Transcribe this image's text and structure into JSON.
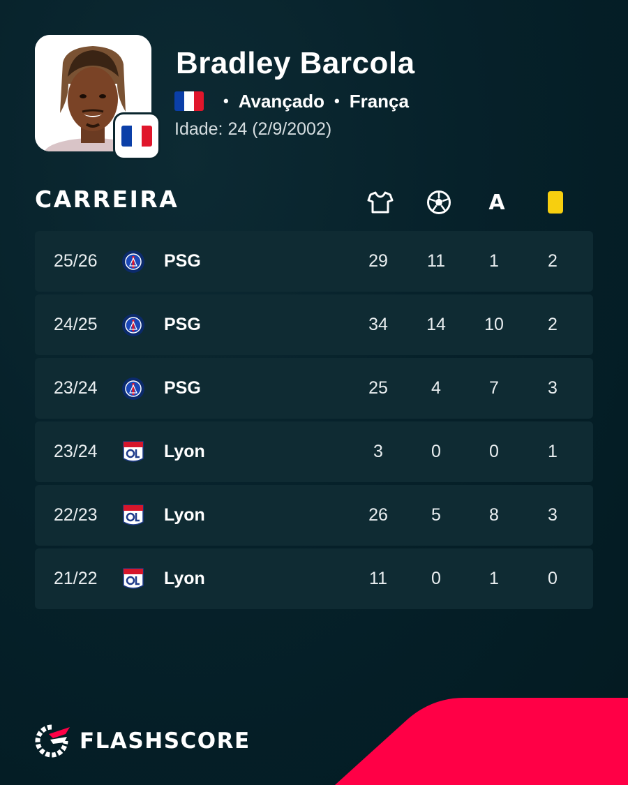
{
  "player": {
    "name": "Bradley Barcola",
    "position": "Avançado",
    "nationality": "França",
    "age_text": "Idade: 24  (2/9/2002)",
    "flag": "france-flag"
  },
  "career": {
    "title": "CARREIRA",
    "columns": [
      {
        "icon": "shirt-icon",
        "meaning": "appearances"
      },
      {
        "icon": "ball-icon",
        "meaning": "goals"
      },
      {
        "icon": "assist-icon",
        "label": "A"
      },
      {
        "icon": "yellow-card-icon",
        "meaning": "yellow cards"
      }
    ],
    "rows": [
      {
        "season": "25/26",
        "club": "PSG",
        "logo": "psg-logo",
        "apps": "29",
        "goals": "11",
        "assists": "1",
        "yellow": "2"
      },
      {
        "season": "24/25",
        "club": "PSG",
        "logo": "psg-logo",
        "apps": "34",
        "goals": "14",
        "assists": "10",
        "yellow": "2"
      },
      {
        "season": "23/24",
        "club": "PSG",
        "logo": "psg-logo",
        "apps": "25",
        "goals": "4",
        "assists": "7",
        "yellow": "3"
      },
      {
        "season": "23/24",
        "club": "Lyon",
        "logo": "lyon-logo",
        "apps": "3",
        "goals": "0",
        "assists": "0",
        "yellow": "1"
      },
      {
        "season": "22/23",
        "club": "Lyon",
        "logo": "lyon-logo",
        "apps": "26",
        "goals": "5",
        "assists": "8",
        "yellow": "3"
      },
      {
        "season": "21/22",
        "club": "Lyon",
        "logo": "lyon-logo",
        "apps": "11",
        "goals": "0",
        "assists": "1",
        "yellow": "0"
      }
    ]
  },
  "brand": {
    "name": "FLASHSCORE"
  },
  "colors": {
    "background": "#041e26",
    "row": "#0f2b33",
    "accent": "#ff0046",
    "card": "#f7cf0f"
  }
}
